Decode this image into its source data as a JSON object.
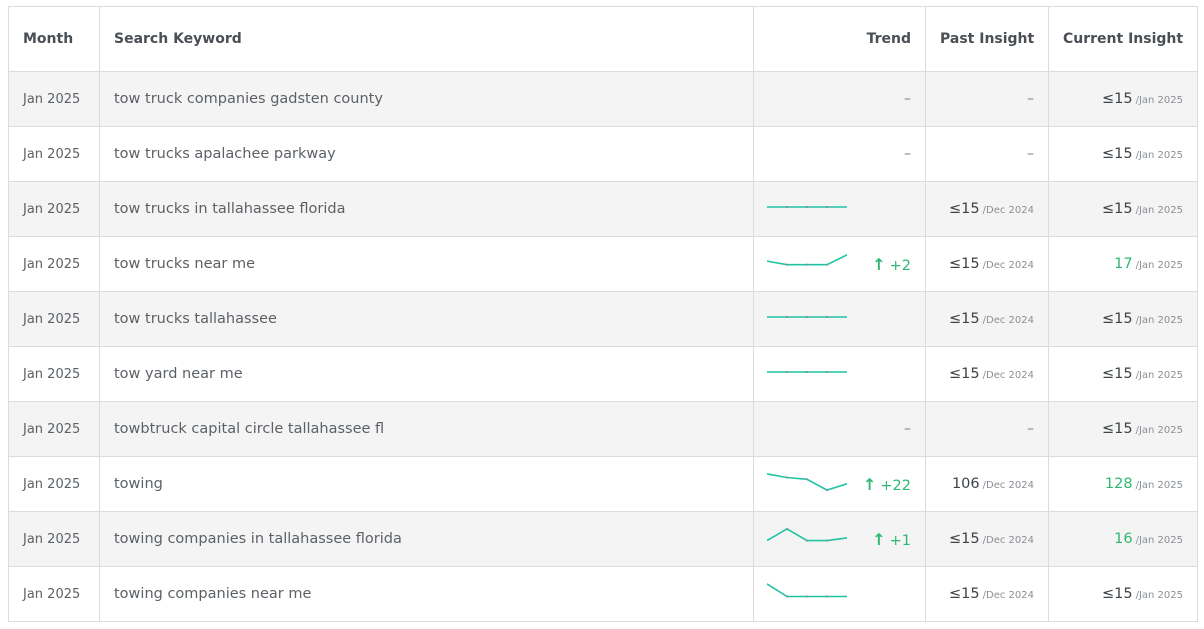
{
  "table": {
    "headers": {
      "month": "Month",
      "keyword": "Search Keyword",
      "trend": "Trend",
      "past": "Past Insight",
      "current": "Current Insight"
    },
    "rows": [
      {
        "month": "Jan 2025",
        "keyword": "tow truck  companies gadsten county",
        "trend": null,
        "delta": "",
        "past_value": "",
        "past_period": "",
        "current_value": "≤15",
        "current_period": "/Jan 2025",
        "current_up": false
      },
      {
        "month": "Jan 2025",
        "keyword": "tow trucks apalachee parkway",
        "trend": null,
        "delta": "",
        "past_value": "",
        "past_period": "",
        "current_value": "≤15",
        "current_period": "/Jan 2025",
        "current_up": false
      },
      {
        "month": "Jan 2025",
        "keyword": "tow trucks in tallahassee florida",
        "trend": [
          0.5,
          0.5,
          0.5,
          0.5,
          0.5
        ],
        "delta": "",
        "past_value": "≤15",
        "past_period": "/Dec 2024",
        "current_value": "≤15",
        "current_period": "/Jan 2025",
        "current_up": false
      },
      {
        "month": "Jan 2025",
        "keyword": "tow trucks near me",
        "trend": [
          0.55,
          0.35,
          0.35,
          0.35,
          0.9
        ],
        "delta": "+2",
        "past_value": "≤15",
        "past_period": "/Dec 2024",
        "current_value": "17",
        "current_period": "/Jan 2025",
        "current_up": true
      },
      {
        "month": "Jan 2025",
        "keyword": "tow trucks tallahassee",
        "trend": [
          0.5,
          0.5,
          0.5,
          0.5,
          0.5
        ],
        "delta": "",
        "past_value": "≤15",
        "past_period": "/Dec 2024",
        "current_value": "≤15",
        "current_period": "/Jan 2025",
        "current_up": false
      },
      {
        "month": "Jan 2025",
        "keyword": "tow yard near me",
        "trend": [
          0.5,
          0.5,
          0.5,
          0.5,
          0.5
        ],
        "delta": "",
        "past_value": "≤15",
        "past_period": "/Dec 2024",
        "current_value": "≤15",
        "current_period": "/Jan 2025",
        "current_up": false
      },
      {
        "month": "Jan 2025",
        "keyword": "towbtruck capital circle tallahassee fl",
        "trend": null,
        "delta": "",
        "past_value": "",
        "past_period": "",
        "current_value": "≤15",
        "current_period": "/Jan 2025",
        "current_up": false
      },
      {
        "month": "Jan 2025",
        "keyword": "towing",
        "trend": [
          0.95,
          0.75,
          0.65,
          0.05,
          0.4
        ],
        "delta": "+22",
        "past_value": "106",
        "past_period": "/Dec 2024",
        "current_value": "128",
        "current_period": "/Jan 2025",
        "current_up": true
      },
      {
        "month": "Jan 2025",
        "keyword": "towing companies in tallahassee florida",
        "trend": [
          0.3,
          0.95,
          0.3,
          0.3,
          0.45
        ],
        "delta": "+1",
        "past_value": "≤15",
        "past_period": "/Dec 2024",
        "current_value": "16",
        "current_period": "/Jan 2025",
        "current_up": true
      },
      {
        "month": "Jan 2025",
        "keyword": "towing companies near me",
        "trend": [
          0.95,
          0.25,
          0.25,
          0.25,
          0.25
        ],
        "delta": "",
        "past_value": "≤15",
        "past_period": "/Dec 2024",
        "current_value": "≤15",
        "current_period": "/Jan 2025",
        "current_up": false
      }
    ],
    "empty_symbol": "–",
    "up_arrow": "↑"
  },
  "colors": {
    "sparkline": "#1fc3a3",
    "positive": "#2eb872",
    "row_alt": "#f4f4f4",
    "border": "#dcdcdc"
  },
  "icons": {
    "trend_up": "arrow-up-icon"
  }
}
